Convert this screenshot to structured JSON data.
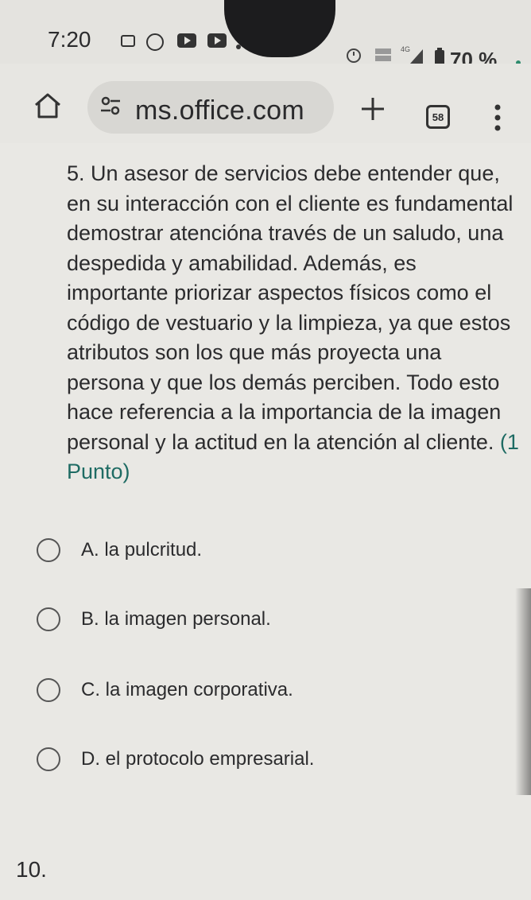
{
  "status_bar": {
    "time": "7:20",
    "battery_percent": "70 %",
    "icons": [
      "cast-icon",
      "whatsapp-icon",
      "youtube-icon",
      "youtube-icon",
      "alarm-icon",
      "volte-icon",
      "signal-icon",
      "battery-icon"
    ]
  },
  "browser": {
    "url": "ms.office.com",
    "tab_count": "58",
    "icons": [
      "home-icon",
      "site-settings-icon",
      "new-tab-icon",
      "tabs-icon",
      "menu-icon"
    ]
  },
  "question": {
    "text": "5. Un asesor de servicios debe entender que, en su interacción con el cliente es fundamental demostrar atencióna través de un saludo, una despedida y amabilidad. Además, es importante priorizar aspectos físicos como el código de vestuario y la limpieza, ya que estos atributos son los que más proyecta una persona y que los demás perciben. Todo esto hace referencia a la importancia de la imagen personal y la actitud en la atención al cliente.",
    "points": "(1 Punto)"
  },
  "options": [
    {
      "label": "A. la pulcritud."
    },
    {
      "label": "B. la imagen personal."
    },
    {
      "label": "C. la imagen corporativa."
    },
    {
      "label": "D. el protocolo empresarial."
    }
  ],
  "next_question": "10."
}
